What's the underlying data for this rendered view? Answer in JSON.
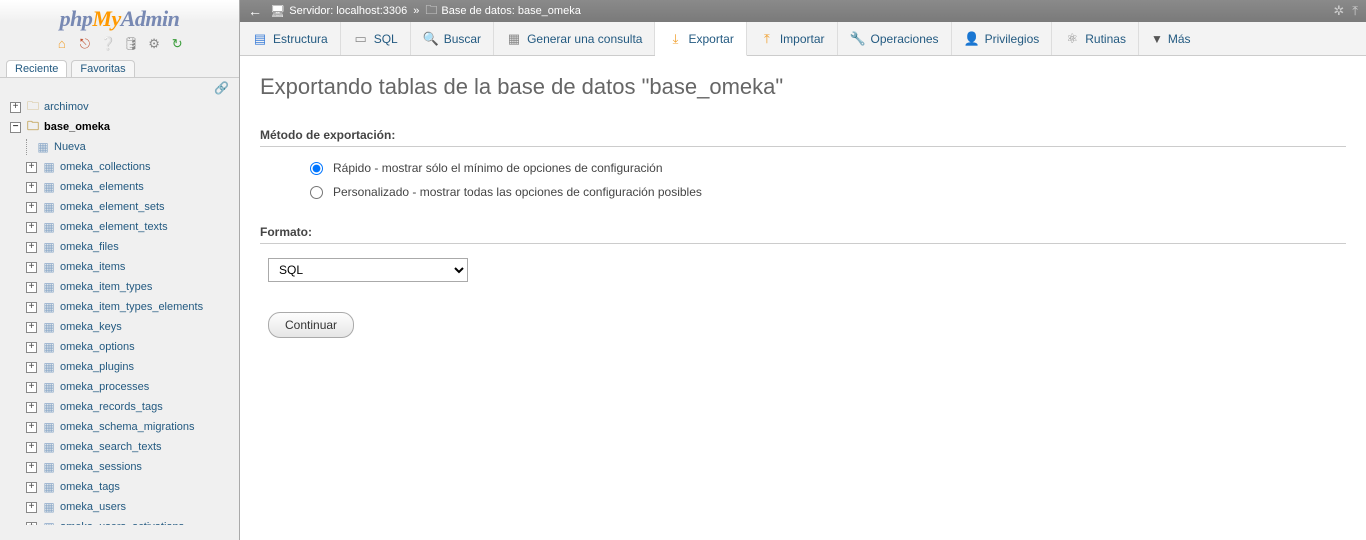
{
  "logo": {
    "p1": "php",
    "p2": "My",
    "p3": "Admin"
  },
  "sidebar_tabs": {
    "recent": "Reciente",
    "favorites": "Favoritas"
  },
  "tree": {
    "db1": "archimov",
    "db2": "base_omeka",
    "new_label": "Nueva",
    "tables": [
      "omeka_collections",
      "omeka_elements",
      "omeka_element_sets",
      "omeka_element_texts",
      "omeka_files",
      "omeka_items",
      "omeka_item_types",
      "omeka_item_types_elements",
      "omeka_keys",
      "omeka_options",
      "omeka_plugins",
      "omeka_processes",
      "omeka_records_tags",
      "omeka_schema_migrations",
      "omeka_search_texts",
      "omeka_sessions",
      "omeka_tags",
      "omeka_users",
      "omeka_users_activations"
    ]
  },
  "breadcrumb": {
    "server_label": "Servidor: localhost:3306",
    "db_label": "Base de datos: base_omeka"
  },
  "tabs": {
    "structure": "Estructura",
    "sql": "SQL",
    "search": "Buscar",
    "qbe": "Generar una consulta",
    "export": "Exportar",
    "import": "Importar",
    "operations": "Operaciones",
    "privileges": "Privilegios",
    "routines": "Rutinas",
    "more": "Más"
  },
  "page": {
    "title": "Exportando tablas de la base de datos \"base_omeka\"",
    "method_label": "Método de exportación:",
    "quick_label": "Rápido - mostrar sólo el mínimo de opciones de configuración",
    "custom_label": "Personalizado - mostrar todas las opciones de configuración posibles",
    "format_label": "Formato:",
    "format_selected": "SQL",
    "go_label": "Continuar"
  }
}
